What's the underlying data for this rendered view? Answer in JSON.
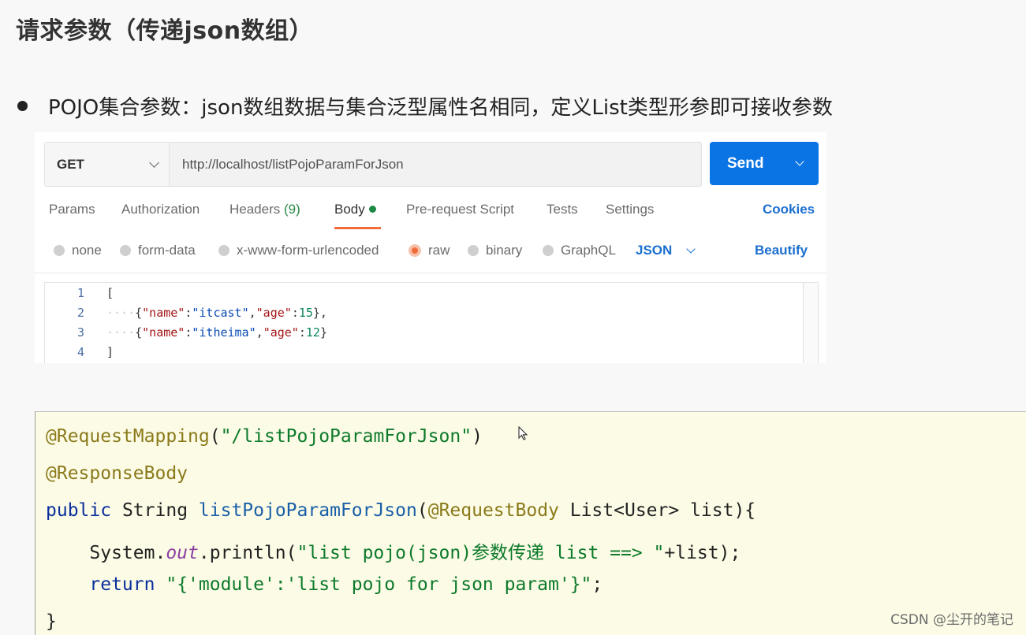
{
  "slide": {
    "title": "请求参数（传递json数组）",
    "bullet": "POJO集合参数：json数组数据与集合泛型属性名相同，定义List类型形参即可接收参数"
  },
  "postman": {
    "method": "GET",
    "url": "http://localhost/listPojoParamForJson",
    "send_label": "Send",
    "tabs": [
      {
        "label": "Params"
      },
      {
        "label": "Authorization"
      },
      {
        "label": "Headers",
        "count": "(9)"
      },
      {
        "label": "Body",
        "active": true
      },
      {
        "label": "Pre-request Script"
      },
      {
        "label": "Tests"
      },
      {
        "label": "Settings"
      }
    ],
    "cookies_label": "Cookies",
    "body_types": [
      "none",
      "form-data",
      "x-www-form-urlencoded",
      "raw",
      "binary",
      "GraphQL"
    ],
    "selected_body_type": "raw",
    "format_select": "JSON",
    "beautify_label": "Beautify",
    "editor": {
      "line_numbers": [
        "1",
        "2",
        "3",
        "4"
      ],
      "open_bracket": "[",
      "close_bracket": "]",
      "items": [
        {
          "name_key": "\"name\"",
          "name_value": "\"itcast\"",
          "age_key": "\"age\"",
          "age_value": "15",
          "trailing": "},"
        },
        {
          "name_key": "\"name\"",
          "name_value": "\"itheima\"",
          "age_key": "\"age\"",
          "age_value": "12",
          "trailing": "}"
        }
      ]
    }
  },
  "code": {
    "annotation_mapping": "@RequestMapping",
    "mapping_path": "\"/listPojoParamForJson\"",
    "annotation_body": "@ResponseBody",
    "kw_public": "public",
    "return_type": "String",
    "method_name": "listPojoParamForJson",
    "param_annotation": "@RequestBody",
    "param_decl": " List<User> list){",
    "println_prefix": "System.",
    "out_field": "out",
    "println_call": ".println(",
    "println_string": "\"list pojo(json)参数传递 list ==> \"",
    "println_suffix": "+list);",
    "kw_return": "return",
    "return_string": "\"{'module':'list pojo for json param'}\"",
    "closing_brace": "}"
  },
  "watermark": "CSDN @尘开的笔记",
  "colors": {
    "send_button": "#0b74e5",
    "active_tab_underline": "#f26b3a",
    "link_blue": "#1b6fcf",
    "code_background": "#fcfbe6"
  }
}
